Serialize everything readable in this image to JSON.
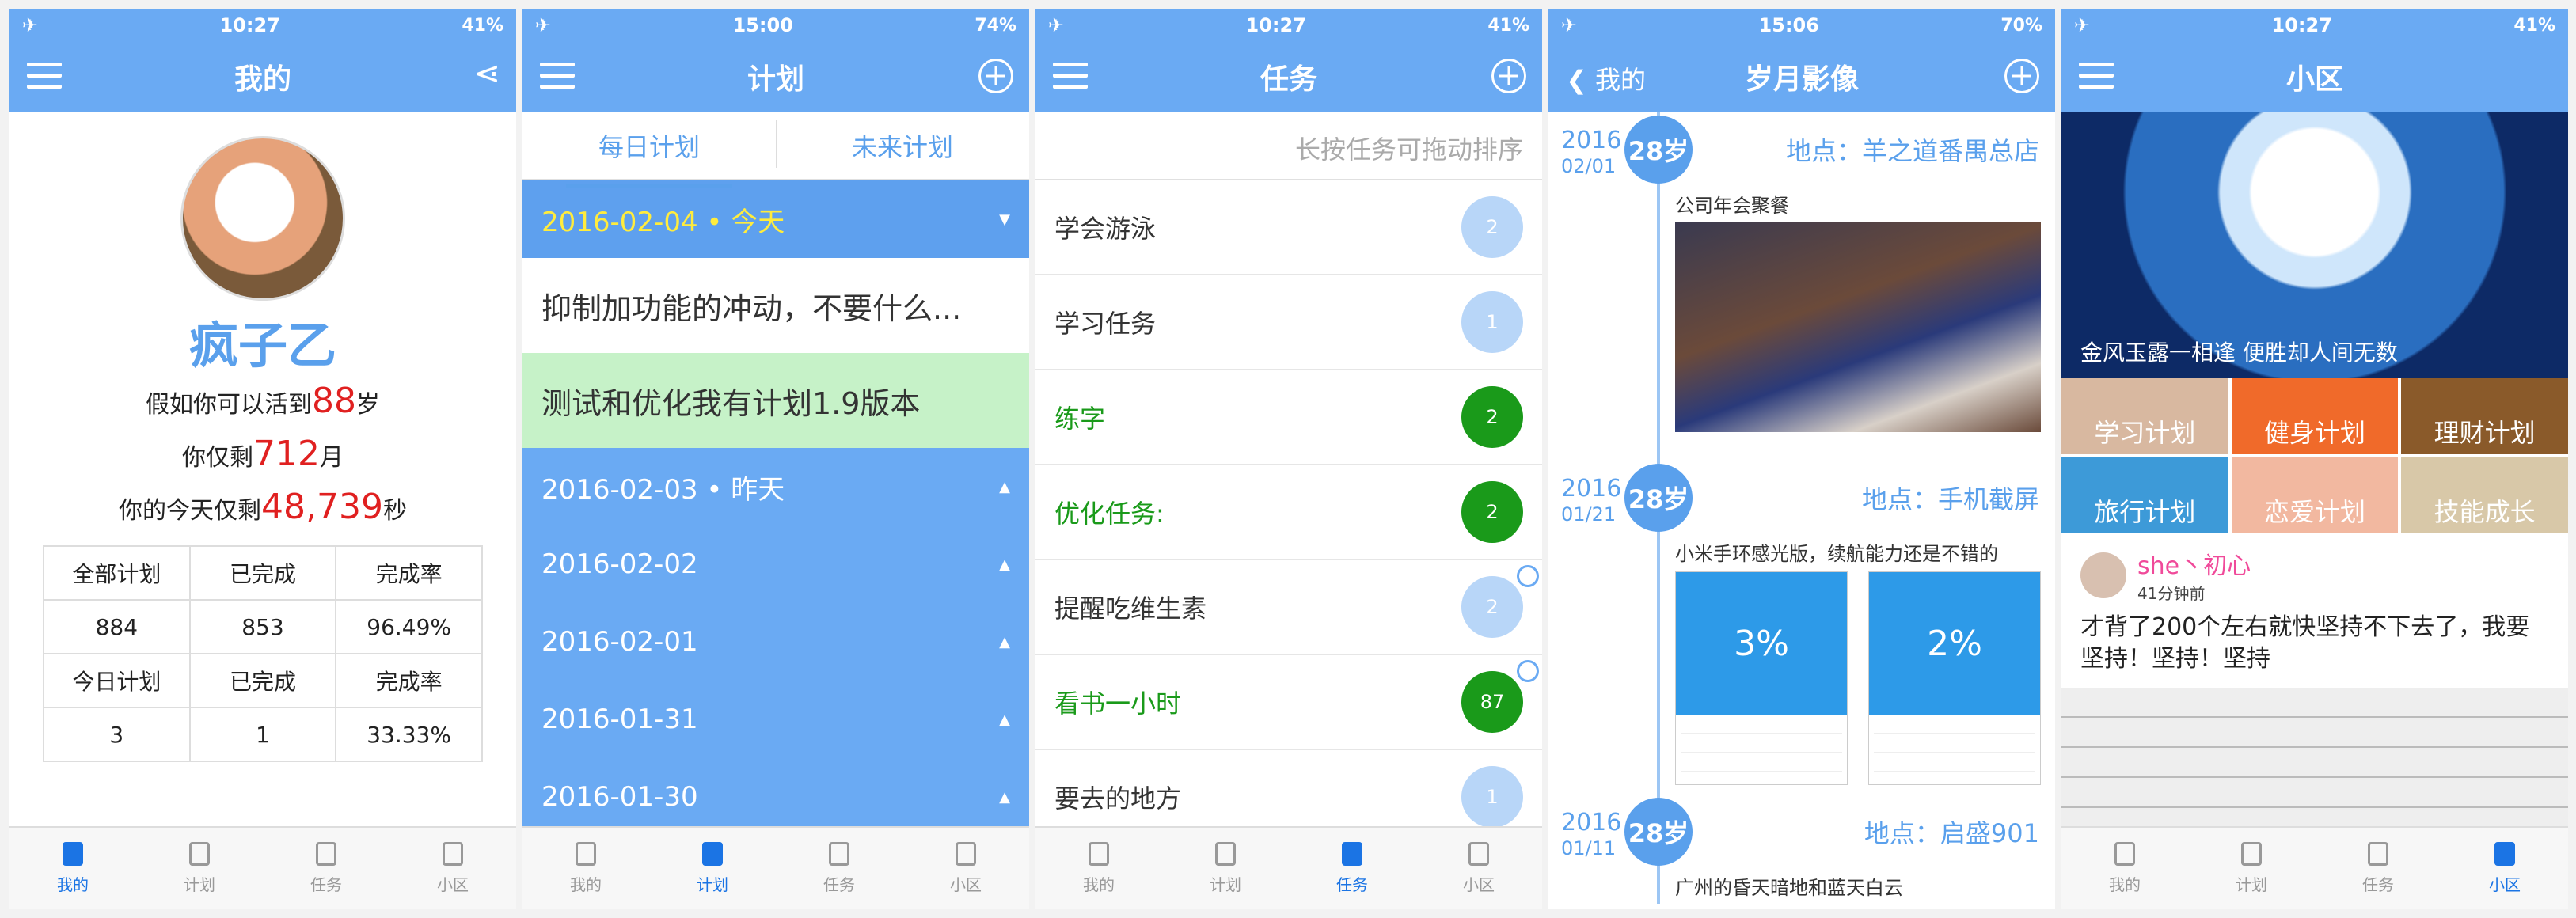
{
  "s1": {
    "time": "10:27",
    "battery": "41%",
    "title": "我的",
    "name": "疯子乙",
    "life": {
      "l1a": "假如你可以活到",
      "l1b": "88",
      "l1c": "岁",
      "l2a": "你仅剩",
      "l2b": "712",
      "l2c": "月",
      "l3a": "你的今天仅剩",
      "l3b": "48,739",
      "l3c": "秒"
    },
    "stats": [
      [
        "全部计划",
        "已完成",
        "完成率"
      ],
      [
        "884",
        "853",
        "96.49%"
      ],
      [
        "今日计划",
        "已完成",
        "完成率"
      ],
      [
        "3",
        "1",
        "33.33%"
      ]
    ]
  },
  "s2": {
    "time": "15:00",
    "battery": "74%",
    "title": "计划",
    "seg": [
      "每日计划",
      "未来计划"
    ],
    "today": "2016-02-04 • 今天",
    "item1": "抑制加功能的冲动，不要什么...",
    "item2": "测试和优化我有计划1.9版本",
    "dates": [
      "2016-02-03 • 昨天",
      "2016-02-02",
      "2016-02-01",
      "2016-01-31",
      "2016-01-30"
    ]
  },
  "s3": {
    "time": "10:27",
    "battery": "41%",
    "title": "任务",
    "hint": "长按任务可拖动排序",
    "tasks": [
      {
        "t": "学会游泳",
        "n": "2"
      },
      {
        "t": "学习任务",
        "n": "1"
      },
      {
        "t": "练字",
        "n": "2"
      },
      {
        "t": "优化任务:",
        "n": "2"
      },
      {
        "t": "提醒吃维生素",
        "n": "2"
      },
      {
        "t": "看书一小时",
        "n": "87"
      },
      {
        "t": "要去的地方",
        "n": "1"
      }
    ]
  },
  "s4": {
    "time": "15:06",
    "battery": "70%",
    "back": "我的",
    "title": "岁月影像",
    "entries": [
      {
        "y": "2016",
        "d": "02/01",
        "age": "28岁",
        "loc": "地点：羊之道番禺总店",
        "cap": "公司年会聚餐"
      },
      {
        "y": "2016",
        "d": "01/21",
        "age": "28岁",
        "loc": "地点：手机截屏",
        "cap": "小米手环感光版，续航能力还是不错的"
      },
      {
        "y": "2016",
        "d": "01/11",
        "age": "28岁",
        "loc": "地点：启盛901",
        "cap": "广州的昏天暗地和蓝天白云"
      }
    ],
    "shots": [
      "3%",
      "2%"
    ]
  },
  "s5": {
    "time": "10:27",
    "battery": "41%",
    "title": "小区",
    "banner": "金风玉露一相逢 便胜却人间无数",
    "cats": [
      "学习计划",
      "健身计划",
      "理财计划",
      "旅行计划",
      "恋爱计划",
      "技能成长"
    ],
    "user": "she丶初心",
    "ago": "41分钟前",
    "text": "才背了200个左右就快坚持不下去了，我要坚持！坚持！坚持"
  },
  "tabs": [
    "我的",
    "计划",
    "任务",
    "小区"
  ]
}
